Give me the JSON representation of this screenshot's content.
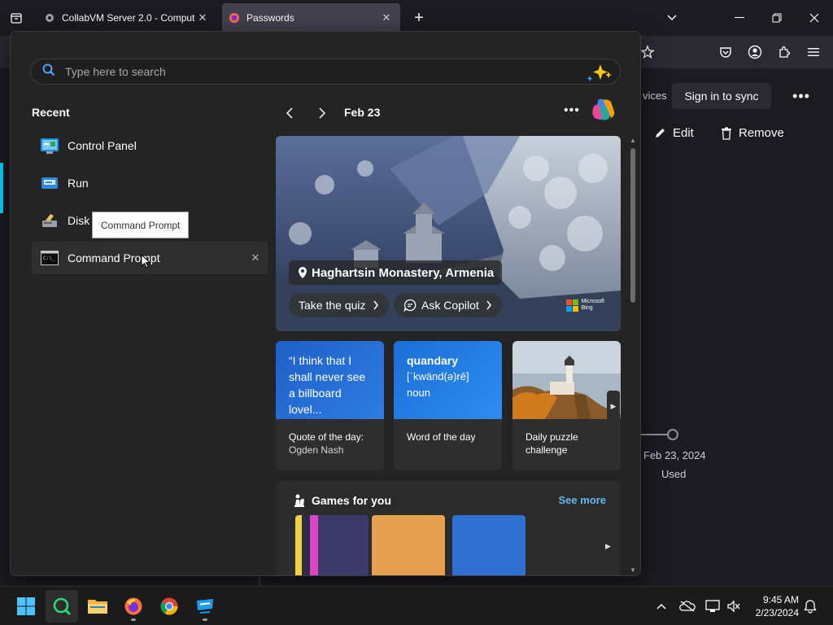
{
  "browser": {
    "tabs": [
      {
        "title": "CollabVM Server 2.0 - Compute",
        "active": false
      },
      {
        "title": "Passwords",
        "active": true
      }
    ]
  },
  "page": {
    "devices_label": "vices",
    "sync_button": "Sign in to sync",
    "edit_label": "Edit",
    "remove_label": "Remove",
    "date": "Feb 23, 2024",
    "used_label": "Used"
  },
  "start_menu": {
    "search_placeholder": "Type here to search",
    "recent_title": "Recent",
    "recent_items": [
      {
        "label": "Control Panel",
        "icon": "control-panel-icon"
      },
      {
        "label": "Run",
        "icon": "run-icon"
      },
      {
        "label": "Disk",
        "icon": "disk-cleanup-icon"
      },
      {
        "label": "Command Prompt",
        "icon": "command-prompt-icon"
      }
    ],
    "tooltip": "Command Prompt",
    "feed": {
      "date": "Feb 23",
      "hero": {
        "location": "Haghartsin Monastery, Armenia",
        "quiz_button": "Take the quiz",
        "copilot_button": "Ask Copilot",
        "brand_line1": "Microsoft",
        "brand_line2": "Bing"
      },
      "cards": [
        {
          "text": "“I think that I shall never see a billboard lovel...",
          "caption": "Quote of the day:",
          "sub": "Ogden Nash"
        },
        {
          "word": "quandary",
          "pron": "[ˈkwänd(ə)rē]",
          "pos": "noun",
          "caption": "Word of the day"
        },
        {
          "caption": "Daily puzzle challenge"
        }
      ],
      "games": {
        "title": "Games for you",
        "see_more": "See more"
      }
    }
  },
  "taskbar": {
    "time": "9:45 AM",
    "date": "2/23/2024"
  },
  "colors": {
    "accent_cyan": "#00ddff",
    "link_blue": "#60b8f5",
    "card_blue": "#1a6fd6"
  }
}
